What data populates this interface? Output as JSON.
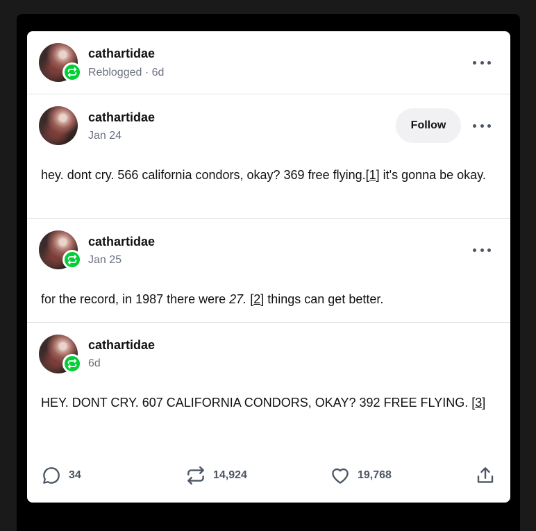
{
  "reblog_header": {
    "username": "cathartidae",
    "meta": "Reblogged · 6d"
  },
  "posts": [
    {
      "username": "cathartidae",
      "date": "Jan 24",
      "follow_label": "Follow",
      "text_before": "hey. dont cry. 566 california condors, okay? 369 free flying.",
      "ref_open": "[",
      "ref_num": "1",
      "ref_close": "]",
      "text_after": " it's gonna be okay."
    },
    {
      "username": "cathartidae",
      "date": "Jan 25",
      "text_before": "for the record, in 1987 there were ",
      "emphasis": "27.",
      "ref_open": " [",
      "ref_num": "2",
      "ref_close": "]",
      "text_after": " things can get better."
    },
    {
      "username": "cathartidae",
      "date": "6d",
      "text_before": "HEY. DONT CRY. 607 CALIFORNIA CONDORS, OKAY? 392 FREE FLYING. ",
      "ref_open": "[",
      "ref_num": "3",
      "ref_close": "]"
    }
  ],
  "actions": {
    "comments": "34",
    "reblogs": "14,924",
    "likes": "19,768"
  },
  "icons": {
    "reblog_badge": "reblog-icon",
    "more": "more-dots-icon",
    "comment": "comment-icon",
    "reblog": "reblog-icon",
    "like": "heart-icon",
    "share": "share-icon"
  },
  "colors": {
    "background": "#1a1a1a",
    "card": "#ffffff",
    "reblog_badge": "#00cf35",
    "meta_text": "#6b7280",
    "action_gray": "#4b5563"
  }
}
